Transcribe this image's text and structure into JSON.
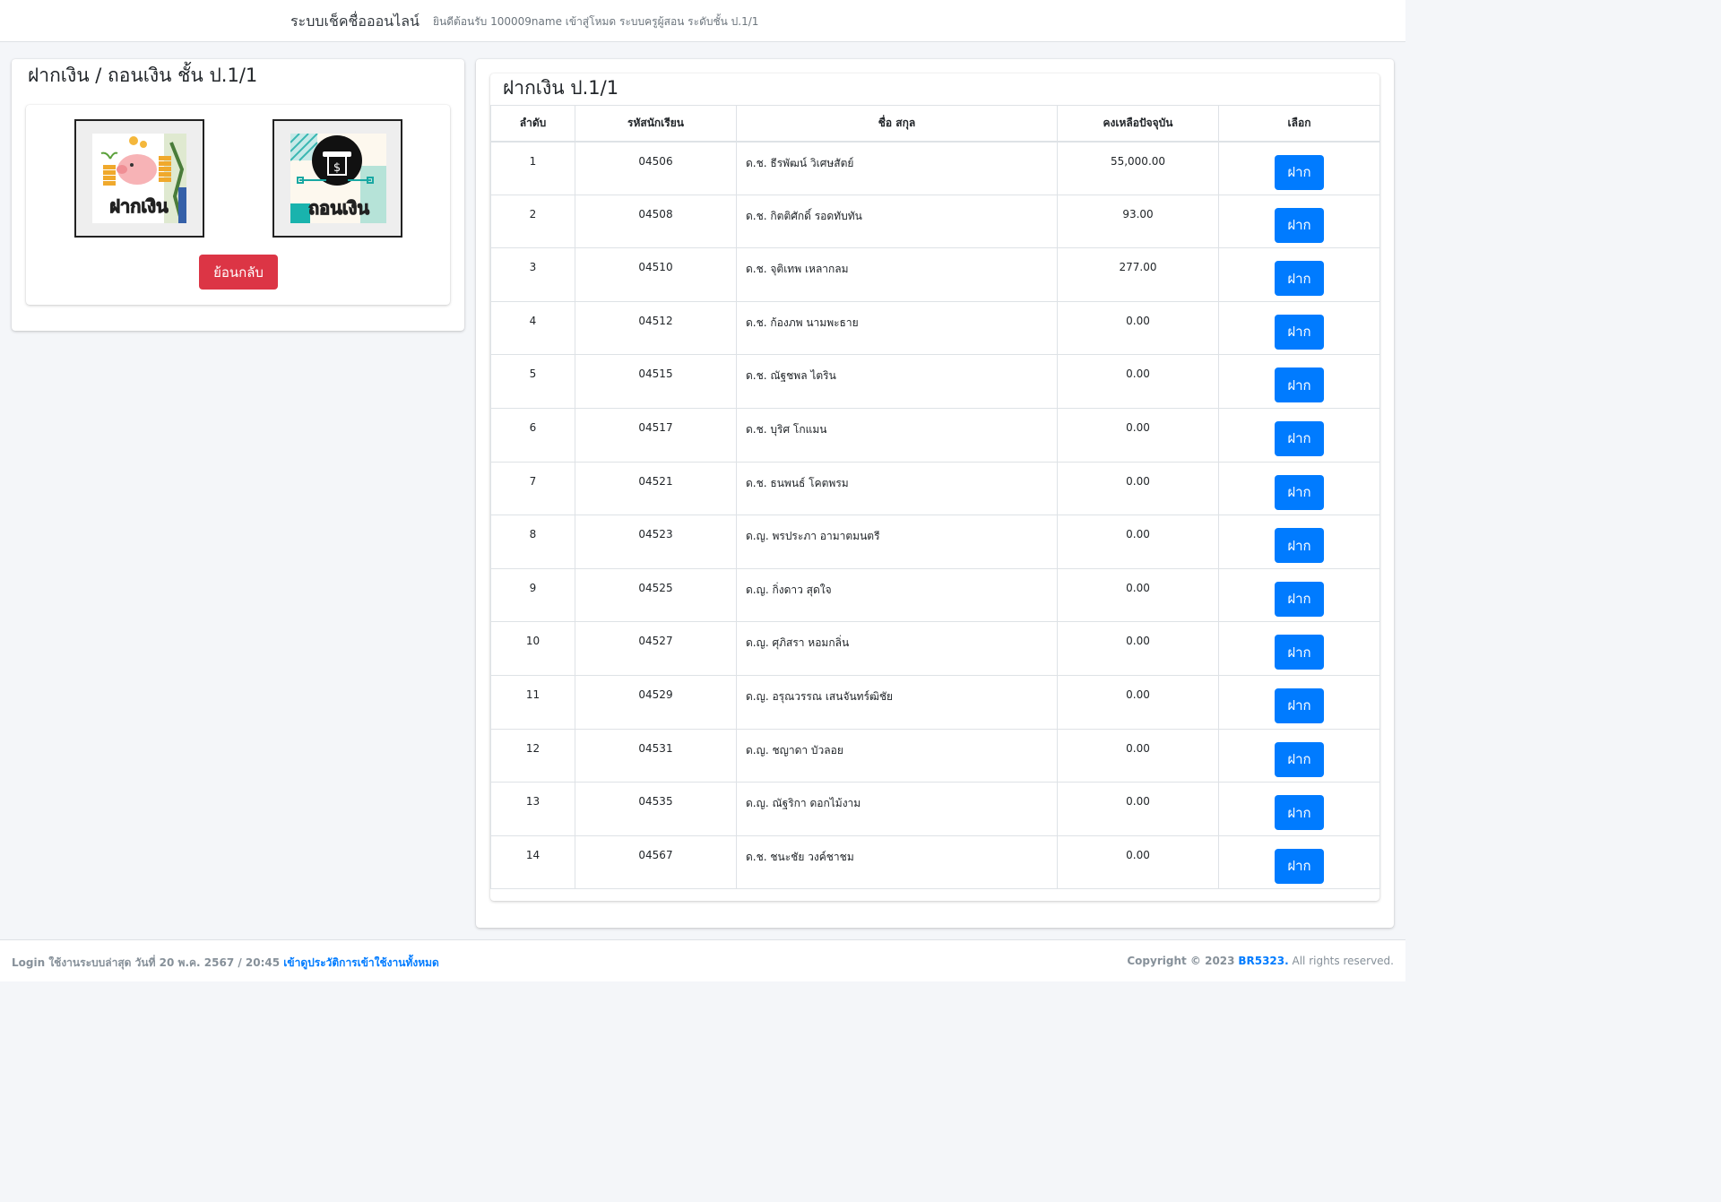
{
  "navbar": {
    "brand": "ระบบเช็คชื่อออนไลน์",
    "welcome": "ยินดีต้อนรับ 100009name เข้าสู่โหมด ระบบครูผู้สอน ระดับชั้น ป.1/1"
  },
  "left_panel": {
    "title": "ฝากเงิน / ถอนเงิน ชั้น ป.1/1",
    "deposit_tile_label": "ฝากเงิน",
    "withdraw_tile_label": "ถอนเงิน",
    "back_button": "ย้อนกลับ"
  },
  "table_panel": {
    "title": "ฝากเงิน ป.1/1",
    "headers": [
      "ลำดับ",
      "รหัสนักเรียน",
      "ชื่อ สกุล",
      "คงเหลือปัจจุบัน",
      "เลือก"
    ],
    "rows": [
      {
        "no": "1",
        "id": "04506",
        "name": "ด.ช. ธีรพัฒน์ วิเศษสัตย์",
        "balance": "55,000.00",
        "action": "ฝาก"
      },
      {
        "no": "2",
        "id": "04508",
        "name": "ด.ช. กิตติศักดิ์ รอดทับทัน",
        "balance": "93.00",
        "action": "ฝาก"
      },
      {
        "no": "3",
        "id": "04510",
        "name": "ด.ช. จุติเทพ เหลากลม",
        "balance": "277.00",
        "action": "ฝาก"
      },
      {
        "no": "4",
        "id": "04512",
        "name": "ด.ช. ก้องภพ นามพะธาย",
        "balance": "0.00",
        "action": "ฝาก"
      },
      {
        "no": "5",
        "id": "04515",
        "name": "ด.ช. ณัฐชพล ไตริน",
        "balance": "0.00",
        "action": "ฝาก"
      },
      {
        "no": "6",
        "id": "04517",
        "name": "ด.ช. บุริศ โกแมน",
        "balance": "0.00",
        "action": "ฝาก"
      },
      {
        "no": "7",
        "id": "04521",
        "name": "ด.ช. ธนพนธ์ โคตพรม",
        "balance": "0.00",
        "action": "ฝาก"
      },
      {
        "no": "8",
        "id": "04523",
        "name": "ด.ญ. พรประภา อามาตมนตรี",
        "balance": "0.00",
        "action": "ฝาก"
      },
      {
        "no": "9",
        "id": "04525",
        "name": "ด.ญ. กิ่งดาว สุดใจ",
        "balance": "0.00",
        "action": "ฝาก"
      },
      {
        "no": "10",
        "id": "04527",
        "name": "ด.ญ. ศุภิสรา หอมกลิ่น",
        "balance": "0.00",
        "action": "ฝาก"
      },
      {
        "no": "11",
        "id": "04529",
        "name": "ด.ญ. อรุณวรรณ เสนจันทร์ฒิชัย",
        "balance": "0.00",
        "action": "ฝาก"
      },
      {
        "no": "12",
        "id": "04531",
        "name": "ด.ญ. ชญาดา บัวลอย",
        "balance": "0.00",
        "action": "ฝาก"
      },
      {
        "no": "13",
        "id": "04535",
        "name": "ด.ญ. ณัฐริกา ดอกไม้งาม",
        "balance": "0.00",
        "action": "ฝาก"
      },
      {
        "no": "14",
        "id": "04567",
        "name": "ด.ช. ชนะชัย วงค์ชาชม",
        "balance": "0.00",
        "action": "ฝาก"
      }
    ]
  },
  "footer": {
    "login_text": "Login ใช้งานระบบล่าสุด วันที่ 20 พ.ค. 2567 / 20:45",
    "history_link": "เข้าดูประวัติการเข้าใช้งานทั้งหมด",
    "copyright_prefix": "Copyright © 2023",
    "copyright_brand": "BR5323.",
    "copyright_suffix": "All rights reserved."
  },
  "colors": {
    "primary": "#007bff",
    "danger": "#dc3545",
    "background": "#f4f6f9"
  }
}
